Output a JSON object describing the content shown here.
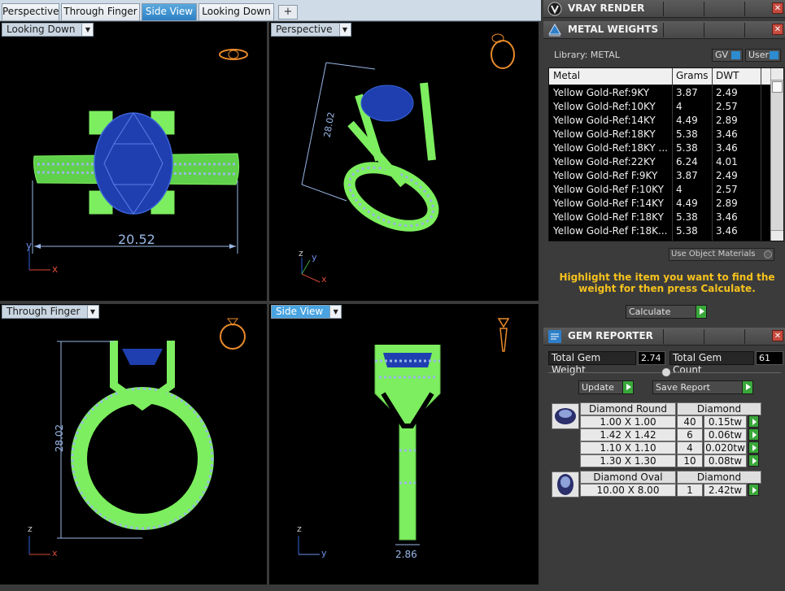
{
  "tabs": [
    {
      "label": "Perspective",
      "active": false
    },
    {
      "label": "Through Finger",
      "active": false
    },
    {
      "label": "Side View",
      "active": true
    },
    {
      "label": "Looking Down",
      "active": false
    }
  ],
  "tab_add_label": "+",
  "viewports": {
    "top_left": {
      "label": "Looking Down",
      "dimension": "20.52",
      "axes": [
        "y",
        "x"
      ]
    },
    "top_right": {
      "label": "Perspective",
      "dimension": "28.02",
      "axes": [
        "z",
        "y",
        "x"
      ]
    },
    "bottom_left": {
      "label": "Through Finger",
      "dimension": "28.02",
      "axes": [
        "z",
        "x"
      ]
    },
    "bottom_right": {
      "label": "Side View",
      "dimension": "2.86",
      "axes": [
        "z",
        "y"
      ]
    }
  },
  "vray": {
    "title": "VRAY RENDER"
  },
  "metal_weights": {
    "title": "METAL WEIGHTS",
    "library_label": "Library: METAL",
    "gv_label": "GV",
    "user_label": "User",
    "columns": [
      "Metal",
      "Grams",
      "DWT"
    ],
    "rows": [
      [
        "Yellow Gold-Ref:9KY",
        "3.87",
        "2.49"
      ],
      [
        "Yellow Gold-Ref:10KY",
        "4",
        "2.57"
      ],
      [
        "Yellow Gold-Ref:14KY",
        "4.49",
        "2.89"
      ],
      [
        "Yellow Gold-Ref:18KY",
        "5.38",
        "3.46"
      ],
      [
        "Yellow Gold-Ref:18KY ...",
        "5.38",
        "3.46"
      ],
      [
        "Yellow Gold-Ref:22KY",
        "6.24",
        "4.01"
      ],
      [
        "Yellow Gold-Ref F:9KY",
        "3.87",
        "2.49"
      ],
      [
        "Yellow Gold-Ref F:10KY",
        "4",
        "2.57"
      ],
      [
        "Yellow Gold-Ref F:14KY",
        "4.49",
        "2.89"
      ],
      [
        "Yellow Gold-Ref F:18KY",
        "5.38",
        "3.46"
      ],
      [
        "Yellow Gold-Ref F:18K...",
        "5.38",
        "3.46"
      ]
    ],
    "use_object_materials": "Use Object Materials",
    "hint": "Highlight the item you want to find the weight for then press Calculate.",
    "calculate_label": "Calculate"
  },
  "gem_reporter": {
    "title": "GEM REPORTER",
    "total_weight_label": "Total Gem Weight",
    "total_weight_value": "2.74",
    "total_count_label": "Total Gem Count",
    "total_count_value": "61",
    "update_label": "Update",
    "save_report_label": "Save Report",
    "groups": [
      {
        "name": "Diamond Round",
        "material": "Diamond",
        "rows": [
          [
            "1.00 X 1.00",
            "40",
            "0.15tw"
          ],
          [
            "1.42 X 1.42",
            "6",
            "0.06tw"
          ],
          [
            "1.10 X 1.10",
            "4",
            "0.020tw"
          ],
          [
            "1.30 X 1.30",
            "10",
            "0.08tw"
          ]
        ]
      },
      {
        "name": "Diamond Oval",
        "material": "Diamond",
        "rows": [
          [
            "10.00 X 8.00",
            "1",
            "2.42tw"
          ]
        ]
      }
    ]
  },
  "colors": {
    "wireframe": "#7dee5f",
    "gem": "#1f3fb0",
    "dimension": "#9ab7e6",
    "hint": "#f6c21d",
    "active_tab": "#3a8fd0"
  }
}
